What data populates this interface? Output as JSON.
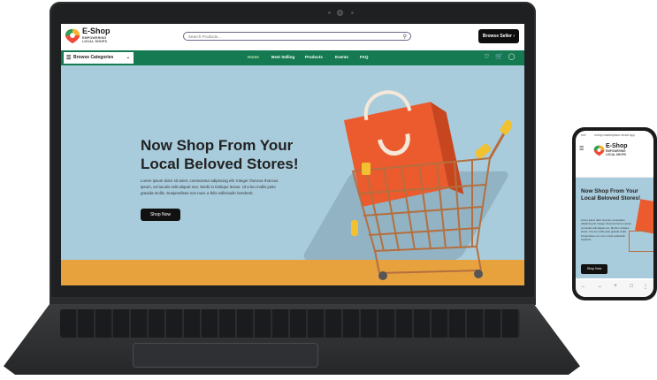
{
  "brand": {
    "name": "E-Shop",
    "tagline": "EMPOWERING LOCAL SHOPS"
  },
  "header": {
    "search_placeholder": "Search Products...",
    "seller_button": "Browse Seller"
  },
  "nav": {
    "browse_label": "Browse Categories",
    "links": [
      "Home",
      "Best Selling",
      "Products",
      "Events",
      "FAQ"
    ],
    "active": "Home"
  },
  "hero": {
    "title": "Now Shop From Your Local Beloved Stores!",
    "body": "Lorem ipsum dolor sit amet, consectetur adipiscing elit. Integer rhoncus rhoncus ipsum, vel iaculis velit aliquet non. Morbi in tristique lectus. Ut a leo mollis justo gravida mollis. Suspendisse non nunc a felis sollicitudin hendrerit.",
    "cta": "Shop Now"
  },
  "mobile": {
    "url": "eshop-marketplace.vercel.app",
    "time": "9:57",
    "title": "Now Shop From Your Local Beloved Stores!",
    "body": "Lorem ipsum dolor sit amet, consectetur adipiscing elit. Integer rhoncus rhoncus ipsum, vel iaculis velit aliquet non. Morbi in tristique lectus. Ut a leo mollis justo gravida mollis. Suspendisse non nunc a felis sollicitudin hendrerit.",
    "cta": "Shop Now"
  },
  "colors": {
    "nav_green": "#157a52",
    "hero_blue": "#a9ccdc",
    "floor_orange": "#e7a23e",
    "bag_red": "#ec5b2e",
    "cart_yellow": "#f1c130"
  },
  "icons": [
    "search-icon",
    "heart-icon",
    "cart-icon",
    "user-icon",
    "menu-icon",
    "chevron-down-icon"
  ]
}
